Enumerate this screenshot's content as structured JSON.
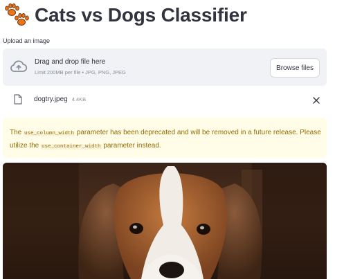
{
  "header": {
    "title": "Cats vs Dogs Classifier",
    "emoji": "paw-prints-emoji"
  },
  "uploader": {
    "label": "Upload an image",
    "drop_title": "Drag and drop file here",
    "drop_sub": "Limit 200MB per file • JPG, PNG, JPEG",
    "browse_label": "Browse files"
  },
  "file": {
    "name": "dogtry.jpeg",
    "size": "4.4KB"
  },
  "warning": {
    "part1": "The ",
    "code1": "use_column_width",
    "part2": " parameter has been deprecated and will be removed in a future release. Please utilize the ",
    "code2": "use_container_width",
    "part3": " parameter instead."
  },
  "image": {
    "subject": "beagle-puppy-photo"
  },
  "colors": {
    "warning_bg": "#fffce7",
    "warning_text": "#926c05",
    "dropzone_bg": "#f0f2f6",
    "paw": "#e8741c"
  }
}
